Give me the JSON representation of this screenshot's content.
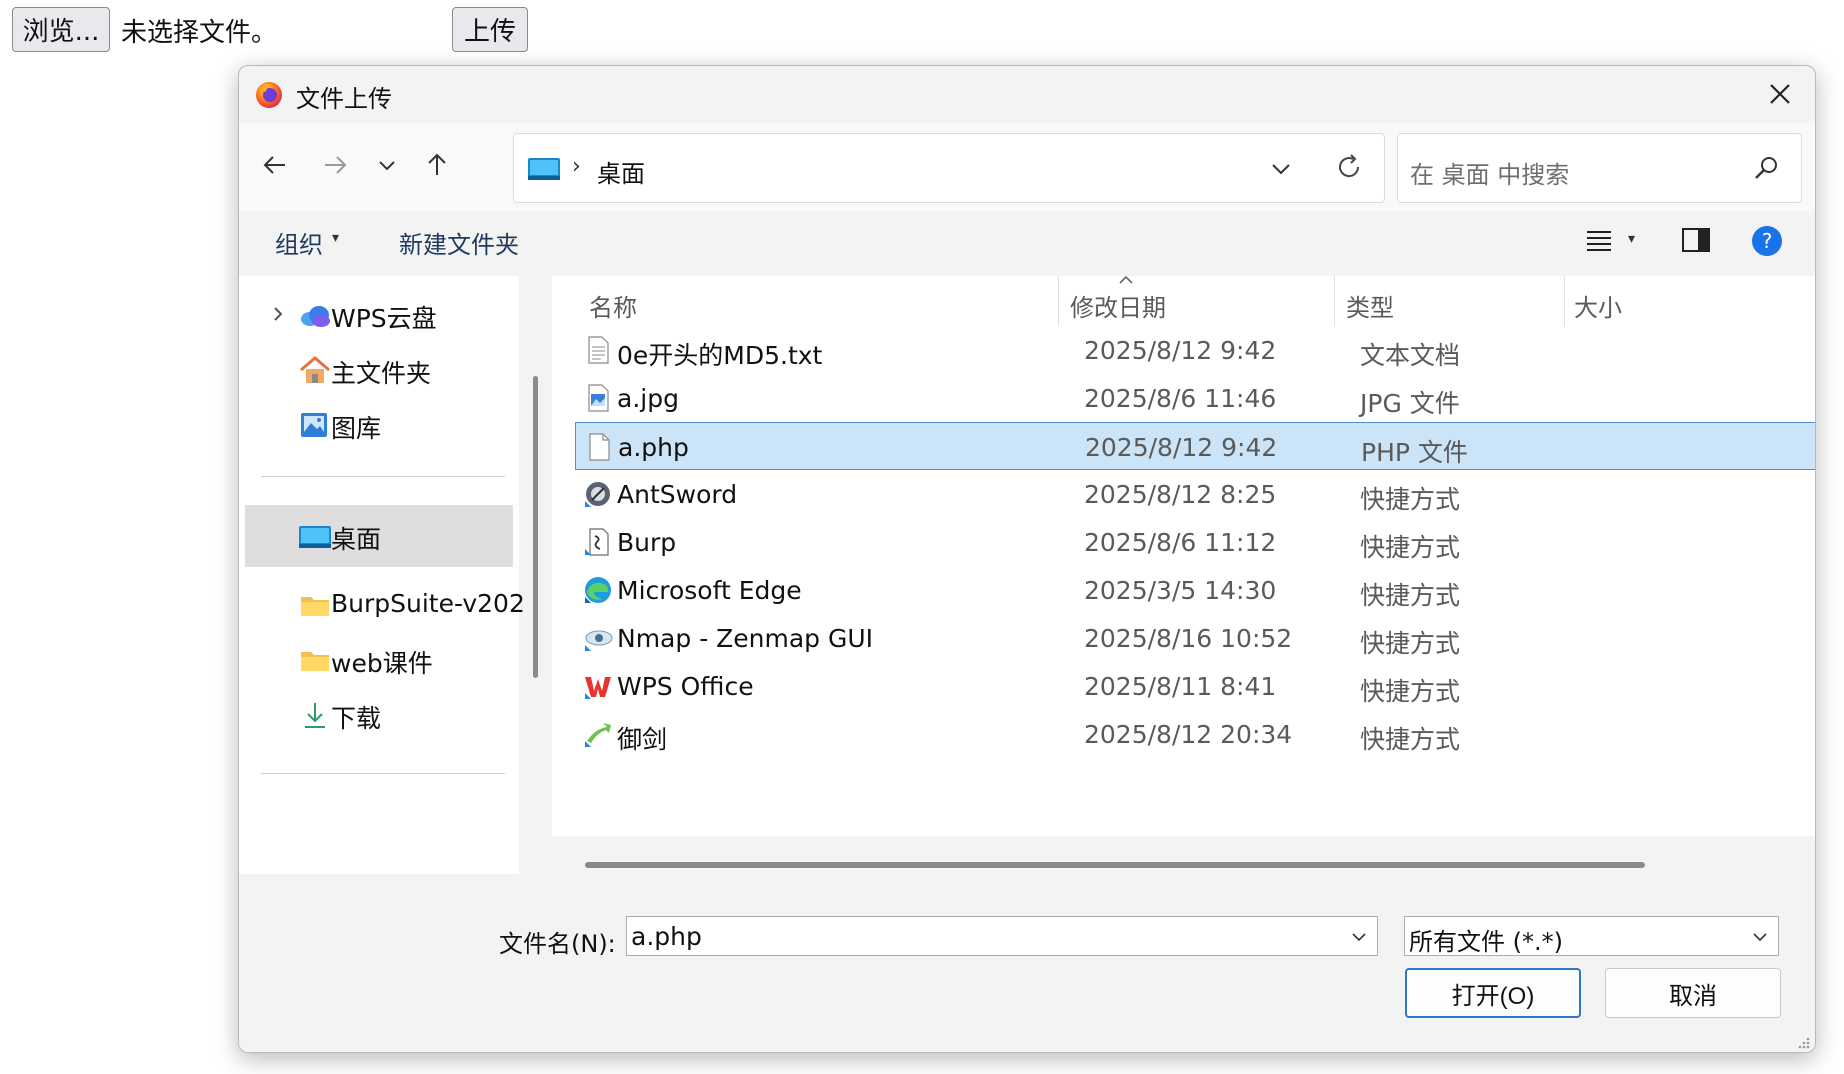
{
  "page": {
    "browse_label": "浏览...",
    "no_file_text": "未选择文件。",
    "upload_label": "上传"
  },
  "dialog": {
    "title": "文件上传",
    "address": {
      "location": "桌面",
      "separator": "›"
    },
    "search": {
      "placeholder": "在 桌面 中搜索"
    },
    "toolbar": {
      "organize": "组织",
      "new_folder": "新建文件夹"
    },
    "sidebar": {
      "items": [
        {
          "label": "WPS云盘",
          "icon": "cloud-icon"
        },
        {
          "label": "主文件夹",
          "icon": "home-icon"
        },
        {
          "label": "图库",
          "icon": "gallery-icon"
        },
        {
          "label": "桌面",
          "icon": "desktop-icon"
        },
        {
          "label": "BurpSuite-v202",
          "icon": "folder-icon"
        },
        {
          "label": "web课件",
          "icon": "folder-icon"
        },
        {
          "label": "下载",
          "icon": "download-icon"
        }
      ]
    },
    "columns": {
      "name": "名称",
      "date": "修改日期",
      "type": "类型",
      "size": "大小"
    },
    "files": [
      {
        "name": "0e开头的MD5.txt",
        "date": "2025/8/12 9:42",
        "type": "文本文档",
        "icon": "text-file-icon"
      },
      {
        "name": "a.jpg",
        "date": "2025/8/6 11:46",
        "type": "JPG 文件",
        "icon": "image-file-icon"
      },
      {
        "name": "a.php",
        "date": "2025/8/12 9:42",
        "type": "PHP 文件",
        "icon": "blank-file-icon",
        "selected": true
      },
      {
        "name": "AntSword",
        "date": "2025/8/12 8:25",
        "type": "快捷方式",
        "icon": "antsword-icon"
      },
      {
        "name": "Burp",
        "date": "2025/8/6 11:12",
        "type": "快捷方式",
        "icon": "burp-icon"
      },
      {
        "name": "Microsoft Edge",
        "date": "2025/3/5 14:30",
        "type": "快捷方式",
        "icon": "edge-icon"
      },
      {
        "name": "Nmap - Zenmap GUI",
        "date": "2025/8/16 10:52",
        "type": "快捷方式",
        "icon": "nmap-icon"
      },
      {
        "name": "WPS Office",
        "date": "2025/8/11 8:41",
        "type": "快捷方式",
        "icon": "wps-icon"
      },
      {
        "name": "御剑",
        "date": "2025/8/12 20:34",
        "type": "快捷方式",
        "icon": "yujian-icon"
      }
    ],
    "footer": {
      "filename_label": "文件名(N):",
      "filename_value": "a.php",
      "filetype_value": "所有文件 (*.*)",
      "open_label": "打开(O)",
      "cancel_label": "取消"
    },
    "colors": {
      "selection_bg": "#cce4f7",
      "selection_border": "#4a90d0",
      "accent": "#2e78c8",
      "help_blue": "#1a73e8"
    }
  }
}
